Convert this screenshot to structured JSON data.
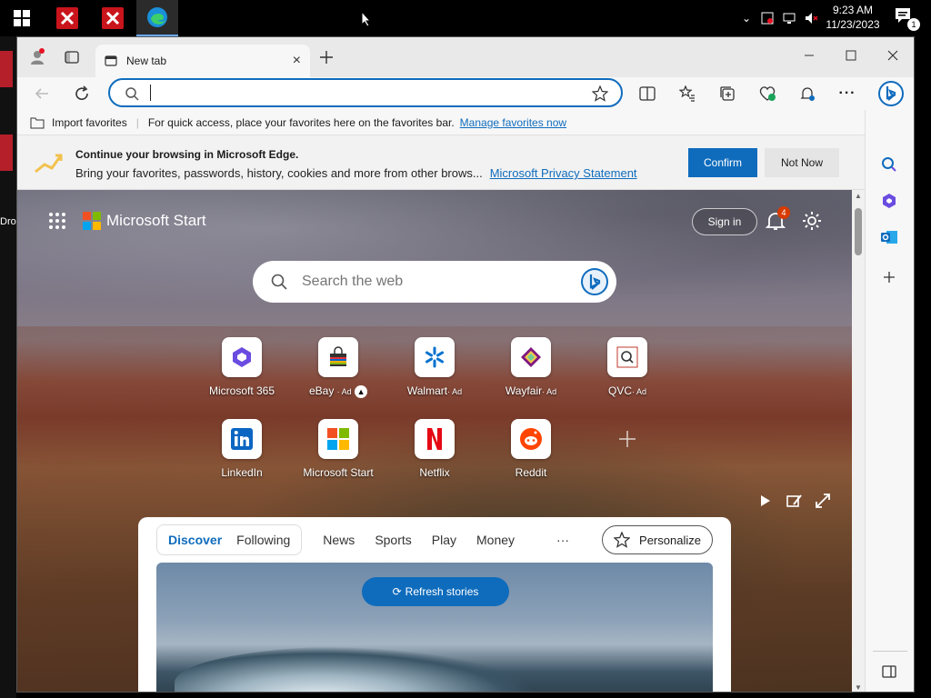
{
  "taskbar": {
    "time": "9:23 AM",
    "date": "11/23/2023",
    "notification_count": "1"
  },
  "desktop": {
    "icon_label": "Dro"
  },
  "browser": {
    "tab_title": "New tab",
    "address_value": "",
    "favorites": {
      "import_label": "Import favorites",
      "message": "For quick access, place your favorites here on the favorites bar.",
      "manage_link": "Manage favorites now"
    },
    "infobar": {
      "title": "Continue your browsing in Microsoft Edge.",
      "body": "Bring your favorites, passwords, history, cookies and more from other brows...",
      "privacy_link": "Microsoft Privacy Statement",
      "confirm_label": "Confirm",
      "not_now_label": "Not Now"
    }
  },
  "start": {
    "brand": "Microsoft Start",
    "sign_in": "Sign in",
    "bell_badge": "4",
    "search_placeholder": "Search the web",
    "tiles_row1": [
      {
        "label": "Microsoft 365",
        "ad": ""
      },
      {
        "label": "eBay",
        "ad": "· Ad"
      },
      {
        "label": "Walmart",
        "ad": "· Ad"
      },
      {
        "label": "Wayfair",
        "ad": "· Ad"
      },
      {
        "label": "QVC",
        "ad": "· Ad"
      }
    ],
    "tiles_row2": [
      {
        "label": "LinkedIn"
      },
      {
        "label": "Microsoft Start"
      },
      {
        "label": "Netflix"
      },
      {
        "label": "Reddit"
      }
    ],
    "feed": {
      "tabs": [
        "Discover",
        "Following",
        "News",
        "Sports",
        "Play",
        "Money",
        "···"
      ],
      "personalize": "Personalize",
      "refresh": "Refresh stories"
    }
  },
  "colors": {
    "accent": "#0f6cbd",
    "badge": "#d83b01"
  }
}
